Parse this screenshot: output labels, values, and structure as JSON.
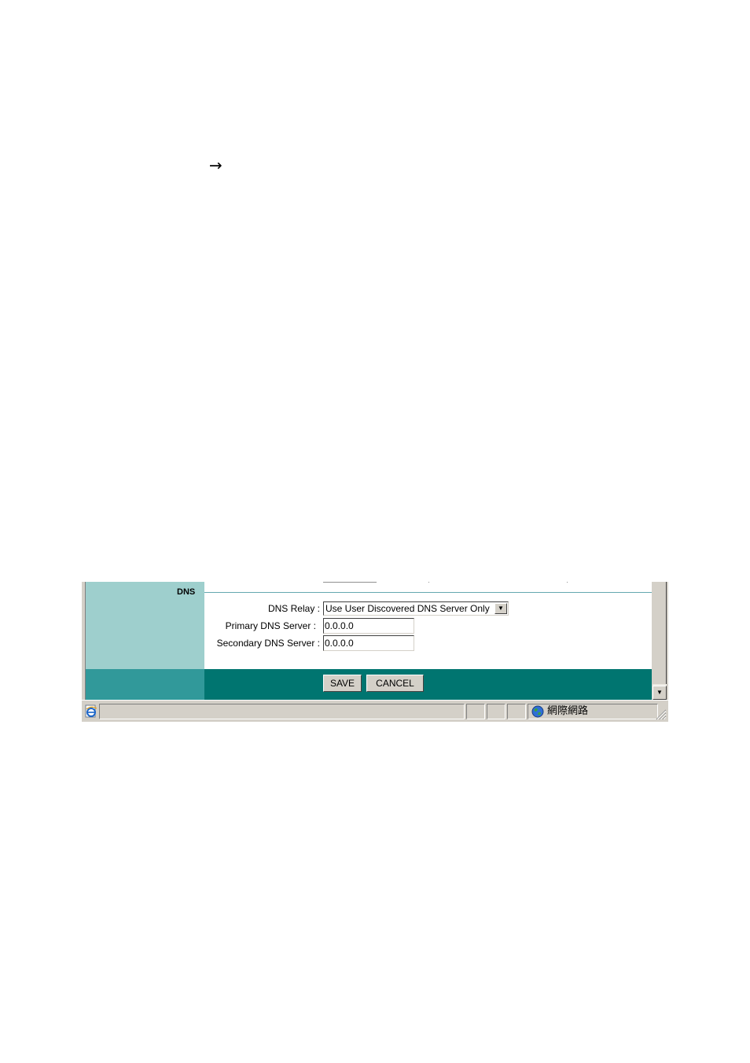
{
  "page": {
    "arrow_glyph": "→"
  },
  "dns_section": {
    "title": "DNS",
    "dns_relay_label": "DNS Relay :",
    "dns_relay_value": "Use User Discovered DNS Server Only",
    "primary_label": "Primary DNS Server :",
    "primary_value": "0.0.0.0",
    "secondary_label": "Secondary DNS Server :",
    "secondary_value": "0.0.0.0"
  },
  "buttons": {
    "save_label": "SAVE",
    "cancel_label": "CANCEL"
  },
  "statusbar": {
    "zone_text": "網際網路",
    "zone_icon": "globe-icon",
    "page_icon": "ie-page-icon"
  },
  "colors": {
    "left_column": "#9ecfcd",
    "footer_bar": "#007570",
    "footer_left": "#31999a",
    "section_line": "#64a8b0"
  }
}
